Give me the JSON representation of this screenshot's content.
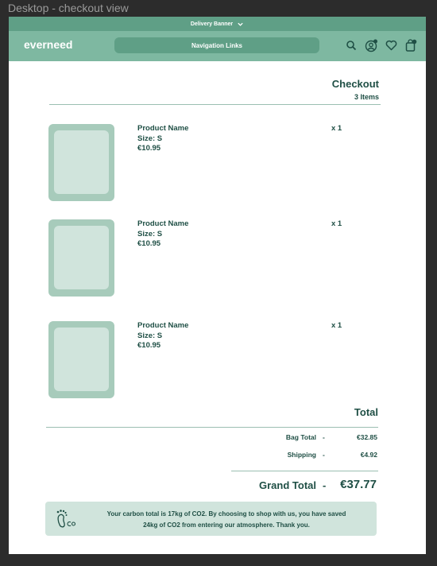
{
  "frame_title": "Desktop - checkout view",
  "banner": {
    "label": "Delivery Banner",
    "icon": "chevron-down-icon"
  },
  "nav": {
    "logo": "everneed",
    "links_label": "Navigation Links",
    "icons": [
      "search-icon",
      "account-icon",
      "heart-icon",
      "bag-icon"
    ]
  },
  "checkout": {
    "title": "Checkout",
    "count": "3 Items"
  },
  "products": [
    {
      "name": "Product Name",
      "size": "Size: S",
      "price": "€10.95",
      "qty": "x 1"
    },
    {
      "name": "Product Name",
      "size": "Size: S",
      "price": "€10.95",
      "qty": "x 1"
    },
    {
      "name": "Product Name",
      "size": "Size: S",
      "price": "€10.95",
      "qty": "x 1"
    }
  ],
  "totals": {
    "title": "Total",
    "bag_label": "Bag Total",
    "bag_value": "€32.85",
    "shipping_label": "Shipping",
    "shipping_value": "€4.92",
    "dash": "-",
    "grand_label": "Grand Total",
    "grand_value": "€37.77"
  },
  "carbon": {
    "line1": "Your carbon total is 17kg of CO2. By choosing to shop with us, you have saved",
    "line2": "24kg of CO2 from entering our atmosphere. Thank you.",
    "icon": "footprint-co2-icon"
  },
  "colors": {
    "banner": "#5f9f86",
    "nav": "#7eb8a1",
    "text": "#1f4f45",
    "thumb": "#a7cbbb",
    "thumb_inner": "#d0e4dc"
  }
}
